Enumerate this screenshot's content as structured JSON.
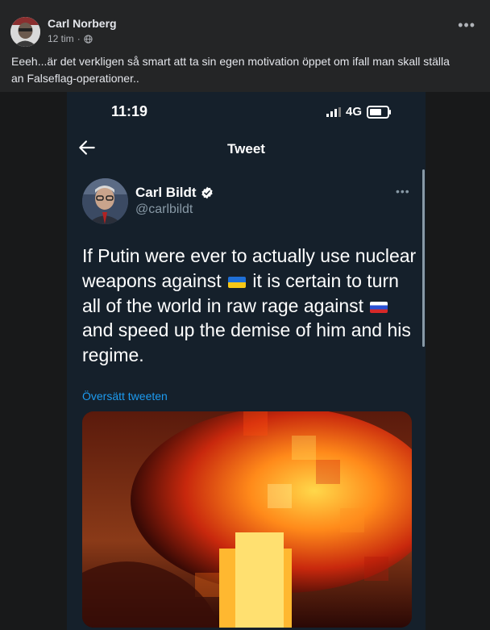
{
  "post": {
    "author": "Carl Norberg",
    "time": "12 tim",
    "privacy_icon": "globe-icon",
    "more_icon": "more-horizontal-icon",
    "text": "Eeeh...är det verkligen så smart att ta sin egen motivation öppet om ifall man skall ställa an Falseflag-operationer.."
  },
  "phone": {
    "time": "11:19",
    "network": "4G",
    "nav_title": "Tweet",
    "back_icon": "arrow-left-icon"
  },
  "tweet": {
    "name": "Carl Bildt",
    "handle": "@carlbildt",
    "verified": true,
    "text_part1": "If Putin were ever to actually use nuclear weapons against",
    "text_part2": "it is certain to turn all of the world in raw rage against",
    "text_part3": "and speed up the demise of him and his regime.",
    "flag1": "ukraine-flag",
    "flag2": "russia-flag",
    "translate": "Översätt tweeten",
    "image": "nuclear-explosion-pixelated"
  },
  "colors": {
    "fb_card": "#242526",
    "twitter_bg": "#15202b",
    "link": "#1d9bf0"
  }
}
